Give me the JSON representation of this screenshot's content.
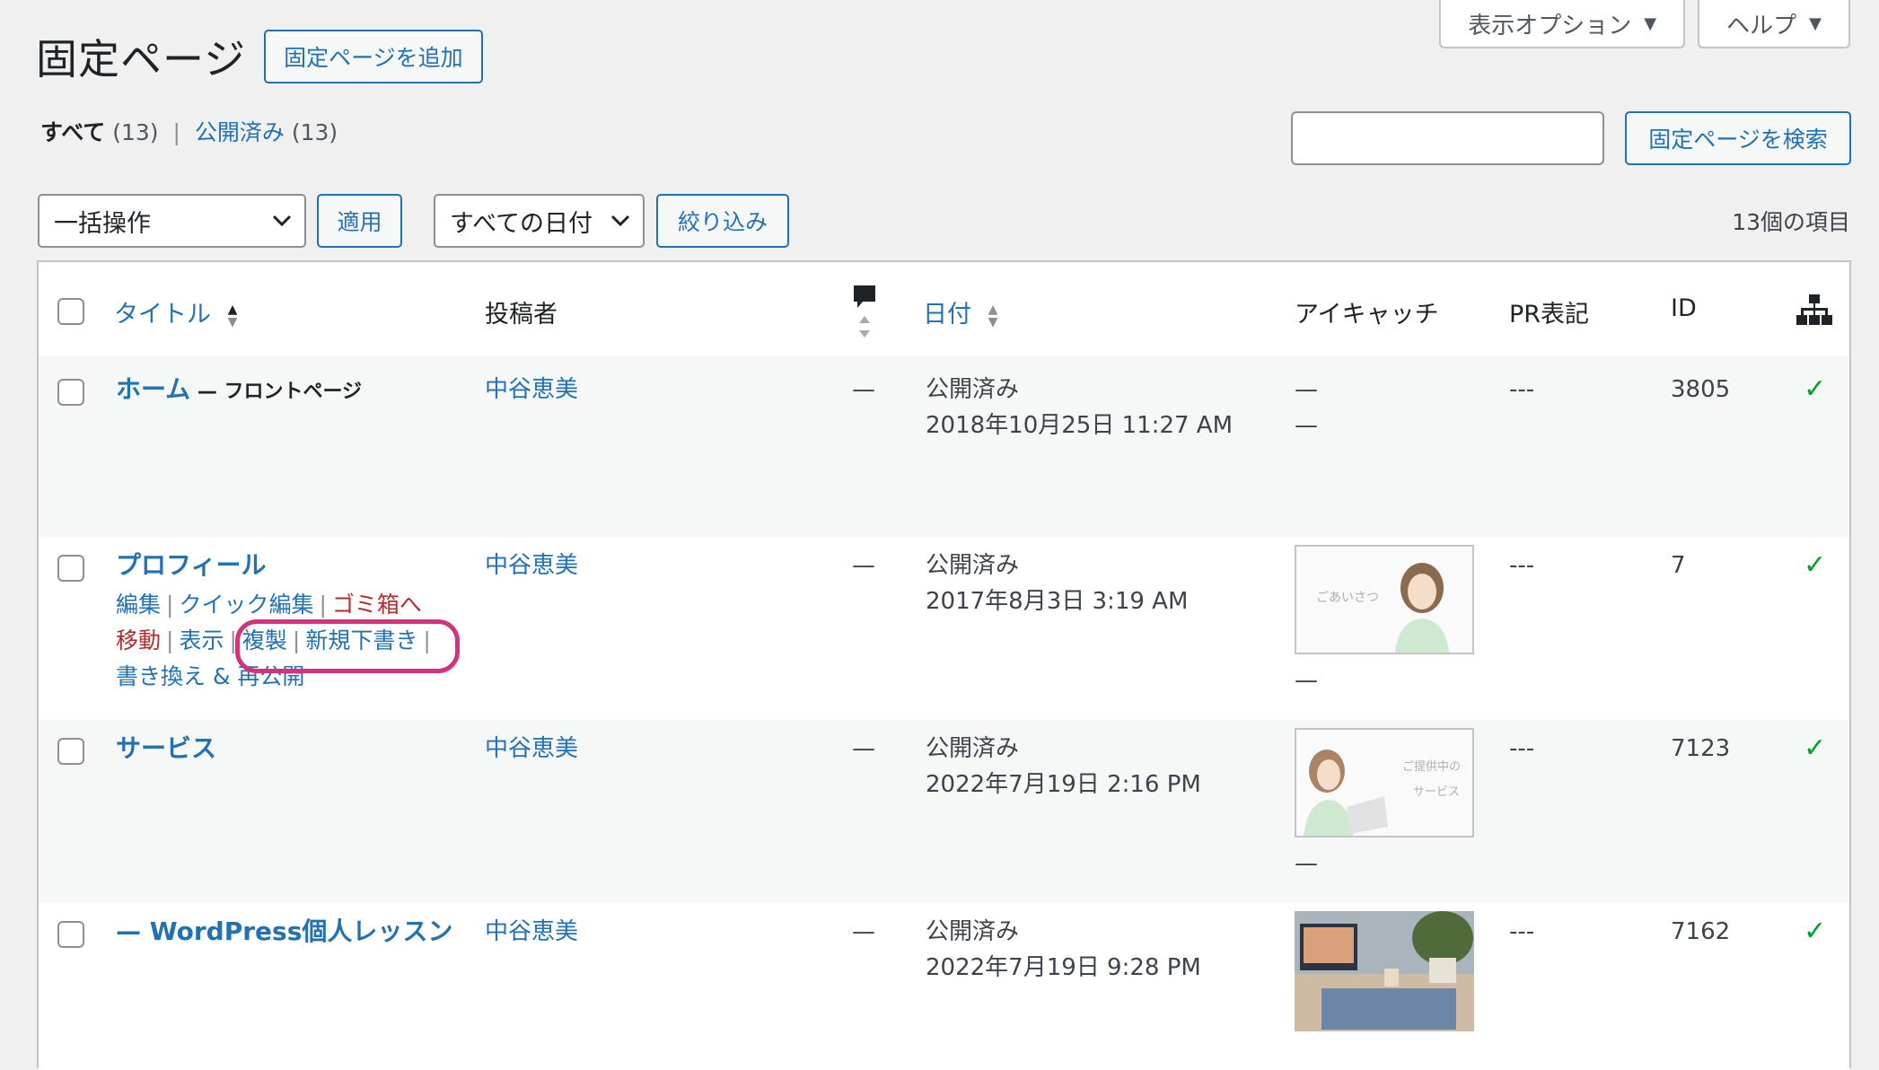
{
  "screen_meta": {
    "options_label": "表示オプション",
    "help_label": "ヘルプ"
  },
  "page": {
    "title": "固定ページ",
    "add_new_label": "固定ページを追加"
  },
  "views": {
    "all_label": "すべて",
    "all_count": "(13)",
    "published_label": "公開済み",
    "published_count": "(13)"
  },
  "search": {
    "input_value": "",
    "button_label": "固定ページを検索"
  },
  "tablenav": {
    "bulk_selected": "一括操作",
    "apply_label": "適用",
    "dates_selected": "すべての日付",
    "filter_label": "絞り込み",
    "items_count": "13個の項目"
  },
  "columns": {
    "title": "タイトル",
    "author": "投稿者",
    "date": "日付",
    "eyecatch": "アイキャッチ",
    "pr": "PR表記",
    "id": "ID"
  },
  "rows": [
    {
      "title": "ホーム",
      "state": " — フロントページ",
      "author": "中谷恵美",
      "comments": "—",
      "status": "公開済み",
      "date": "2018年10月25日 11:27 AM",
      "eyecatch_a": "—",
      "eyecatch_b": "—",
      "pr": "---",
      "id": "3805",
      "check": "✓"
    },
    {
      "title": "プロフィール",
      "author": "中谷恵美",
      "comments": "—",
      "status": "公開済み",
      "date": "2017年8月3日 3:19 AM",
      "eyecatch_text": "ごあいさつ",
      "eyecatch_b": "—",
      "pr": "---",
      "id": "7",
      "check": "✓",
      "actions": {
        "edit": "編集",
        "quick_edit": "クイック編集",
        "trash_line1": "ゴミ箱へ",
        "trash_line2": "移動",
        "view": "表示",
        "duplicate": "複製",
        "new_draft": "新規下書き",
        "rewrite": "書き換え & 再公開"
      }
    },
    {
      "title": "サービス",
      "author": "中谷恵美",
      "comments": "—",
      "status": "公開済み",
      "date": "2022年7月19日 2:16 PM",
      "eyecatch_text_1": "ご提供中の",
      "eyecatch_text_2": "サービス",
      "eyecatch_b": "—",
      "pr": "---",
      "id": "7123",
      "check": "✓"
    },
    {
      "title": "— WordPress個人レッスン",
      "author": "中谷恵美",
      "comments": "—",
      "status": "公開済み",
      "date": "2022年7月19日 9:28 PM",
      "pr": "---",
      "id": "7162",
      "check": "✓"
    }
  ],
  "colors": {
    "link": "#2271b1",
    "trash": "#b32d2e",
    "highlight": "#d2337a",
    "check": "#00a32a"
  },
  "icons": [
    "comment-bubble-icon",
    "sitemap-icon",
    "sort-arrows-icon",
    "chevron-down-icon",
    "triangle-down-icon"
  ]
}
